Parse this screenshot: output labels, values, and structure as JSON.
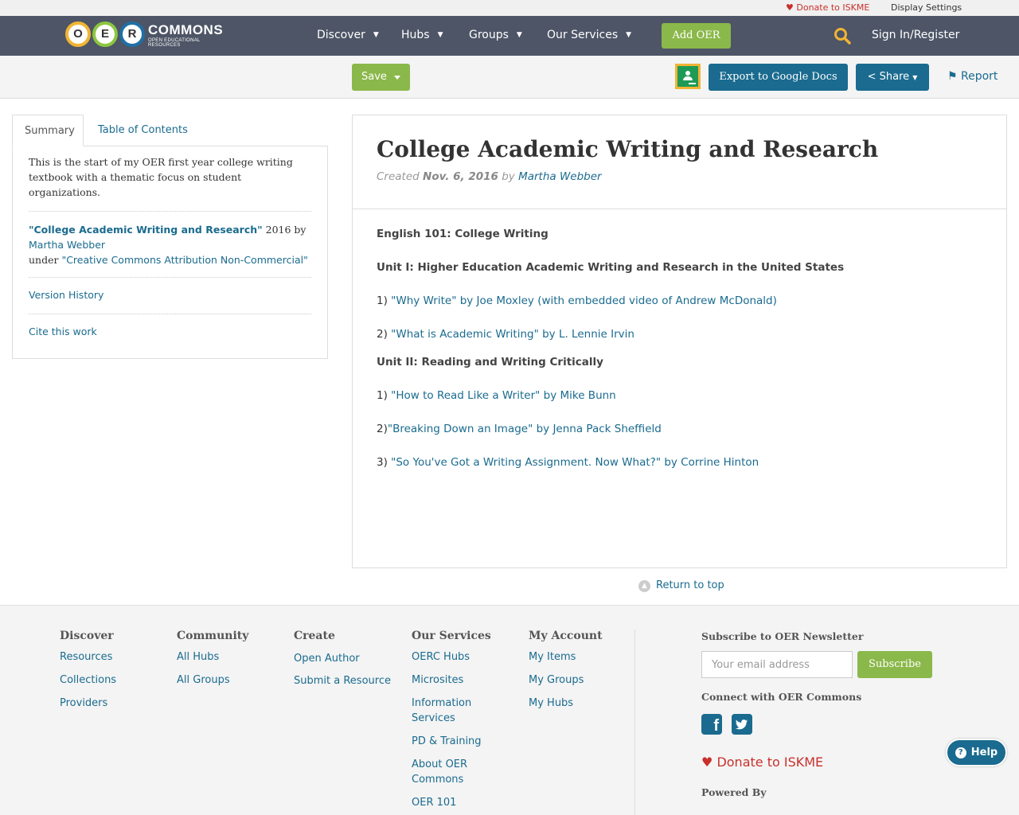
{
  "utility": {
    "donate": "Donate to ISKME",
    "display_settings": "Display Settings"
  },
  "nav": {
    "logo_letters": [
      "O",
      "E",
      "R"
    ],
    "logo_word": "COMMONS",
    "logo_sub": "OPEN EDUCATIONAL RESOURCES",
    "items": [
      {
        "label": "Discover"
      },
      {
        "label": "Hubs"
      },
      {
        "label": "Groups"
      },
      {
        "label": "Our Services"
      }
    ],
    "add_oer": "Add OER",
    "sign_in": "Sign In/Register"
  },
  "toolbar": {
    "save": "Save",
    "export": "Export to Google Docs",
    "share": "Share",
    "report": "Report"
  },
  "sidebar": {
    "tabs": [
      "Summary",
      "Table of Contents"
    ],
    "description": "This is the start of my OER first year college writing textbook with a thematic focus on student organizations.",
    "attribution": {
      "title": "\"College Academic Writing and Research\"",
      "year_by": " 2016 by",
      "author": "Martha Webber",
      "under": "under ",
      "license": "\"Creative Commons Attribution Non-Commercial\""
    },
    "version_history": "Version History",
    "cite": "Cite this work"
  },
  "article": {
    "title": "College Academic Writing and Research",
    "meta": {
      "created_label": "Created ",
      "date": "Nov. 6, 2016",
      "by": " by ",
      "author": "Martha Webber"
    },
    "course": "English 101: College Writing",
    "unit1": "Unit I: Higher Education Academic Writing and Research in the United States",
    "unit1_items": [
      {
        "num": "1) ",
        "link": "\"Why Write\" by Joe Moxley (with embedded video of Andrew McDonald)"
      },
      {
        "num": "2) ",
        "link": "\"What is Academic Writing\" by L. Lennie Irvin"
      }
    ],
    "unit2": "Unit II: Reading and Writing Critically",
    "unit2_items": [
      {
        "num": "1) ",
        "link": "\"How to Read Like a Writer\" by Mike Bunn"
      },
      {
        "num": "2)",
        "link": "\"Breaking Down an Image\" by Jenna Pack Sheffield"
      },
      {
        "num": "3) ",
        "link": "\"So You've Got a Writing Assignment. Now What?\" by Corrine Hinton"
      }
    ]
  },
  "return_to_top": "Return to top",
  "footer": {
    "columns": [
      {
        "heading": "Discover",
        "links": [
          "Resources",
          "Collections",
          "Providers"
        ]
      },
      {
        "heading": "Community",
        "links": [
          "All Hubs",
          "All Groups"
        ]
      },
      {
        "heading": "Create",
        "links": [
          "Open Author",
          "Submit a Resource"
        ]
      },
      {
        "heading": "Our Services",
        "links": [
          "OERC Hubs",
          "Microsites",
          "Information Services",
          "PD & Training",
          "About OER Commons",
          "OER 101"
        ]
      },
      {
        "heading": "My Account",
        "links": [
          "My Items",
          "My Groups",
          "My Hubs"
        ]
      }
    ],
    "newsletter_title": "Subscribe to OER Newsletter",
    "email_placeholder": "Your email address",
    "subscribe": "Subscribe",
    "connect": "Connect with OER Commons",
    "donate": "Donate to ISKME",
    "powered_by": "Powered By"
  },
  "help": "Help",
  "colors": {
    "nav_bg": "#4d5566",
    "accent_green": "#8bb84a",
    "link_blue": "#1a6b8f",
    "donate_red": "#c9302c"
  },
  "icons": [
    "heart-icon",
    "search-icon",
    "chevron-down-icon",
    "google-classroom-icon",
    "share-icon",
    "flag-icon",
    "chevron-up-icon",
    "facebook-icon",
    "twitter-icon",
    "help-icon"
  ]
}
